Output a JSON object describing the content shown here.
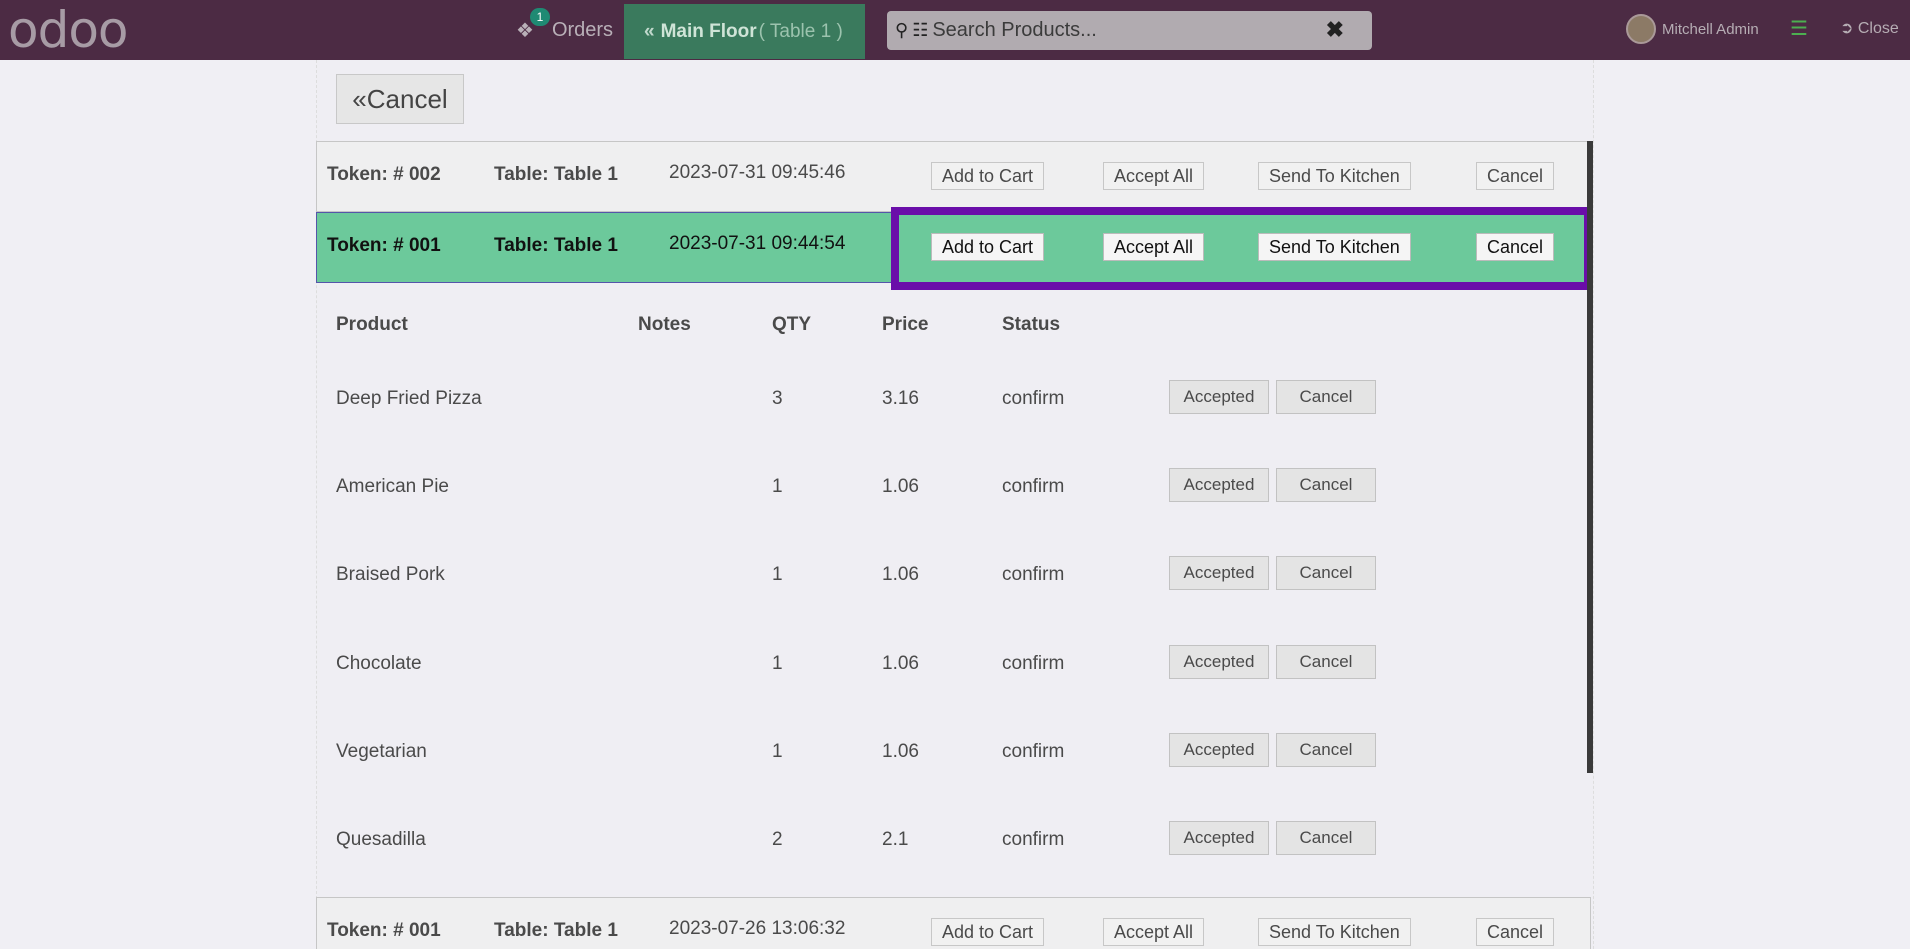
{
  "topbar": {
    "logo": "odoo",
    "orders_label": "Orders",
    "orders_count": "1",
    "floor_label": "Main Floor",
    "floor_table": "( Table 1 )",
    "search_placeholder": "Search Products...",
    "user_name": "Mitchell Admin",
    "close_label": "Close"
  },
  "cancel_label": "Cancel",
  "orders": [
    {
      "token": "Token: # 002",
      "table": "Table: Table 1",
      "date": "2023-07-31 09:45:46",
      "add": "Add to Cart",
      "accept": "Accept All",
      "kitchen": "Send To Kitchen",
      "cancel": "Cancel"
    },
    {
      "token": "Token: # 001",
      "table": "Table: Table 1",
      "date": "2023-07-31 09:44:54",
      "add": "Add to Cart",
      "accept": "Accept All",
      "kitchen": "Send To Kitchen",
      "cancel": "Cancel"
    },
    {
      "token": "Token: # 001",
      "table": "Table: Table 1",
      "date": "2023-07-26 13:06:32",
      "add": "Add to Cart",
      "accept": "Accept All",
      "kitchen": "Send To Kitchen",
      "cancel": "Cancel"
    }
  ],
  "lines_header": {
    "product": "Product",
    "notes": "Notes",
    "qty": "QTY",
    "price": "Price",
    "status": "Status"
  },
  "lines": [
    {
      "product": "Deep Fried Pizza",
      "qty": "3",
      "price": "3.16",
      "status": "confirm",
      "accepted": "Accepted",
      "cancel": "Cancel"
    },
    {
      "product": "American Pie",
      "qty": "1",
      "price": "1.06",
      "status": "confirm",
      "accepted": "Accepted",
      "cancel": "Cancel"
    },
    {
      "product": "Braised Pork",
      "qty": "1",
      "price": "1.06",
      "status": "confirm",
      "accepted": "Accepted",
      "cancel": "Cancel"
    },
    {
      "product": "Chocolate",
      "qty": "1",
      "price": "1.06",
      "status": "confirm",
      "accepted": "Accepted",
      "cancel": "Cancel"
    },
    {
      "product": "Vegetarian",
      "qty": "1",
      "price": "1.06",
      "status": "confirm",
      "accepted": "Accepted",
      "cancel": "Cancel"
    },
    {
      "product": "Quesadilla",
      "qty": "2",
      "price": "2.1",
      "status": "confirm",
      "accepted": "Accepted",
      "cancel": "Cancel"
    }
  ],
  "colors": {
    "topbar": "#4c2b44",
    "active_row": "#6cc99b",
    "highlight": "#6a0ea9",
    "floor_button": "#3a7a5d"
  }
}
